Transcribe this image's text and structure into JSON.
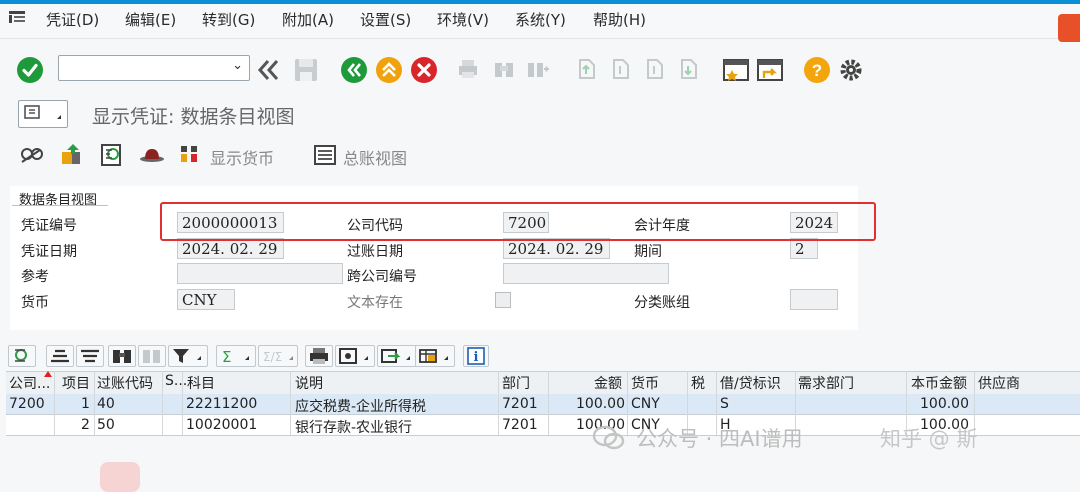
{
  "menu": {
    "items": [
      "凭证(D)",
      "编辑(E)",
      "转到(G)",
      "附加(A)",
      "设置(S)",
      "环境(V)",
      "系统(Y)",
      "帮助(H)"
    ]
  },
  "toolbar": {
    "command_value": "",
    "icons": [
      "enter-icon",
      "back-icon",
      "save-icon",
      "back-green-icon",
      "exit-icon",
      "cancel-icon",
      "print-icon",
      "find-icon",
      "find-next-icon",
      "first-page-icon",
      "prev-page-icon",
      "next-page-icon",
      "last-page-icon",
      "create-session-icon",
      "shortcut-icon",
      "help-icon",
      "settings-icon"
    ]
  },
  "page": {
    "title": "显示凭证: 数据条目视图"
  },
  "app_toolbar": {
    "display_currency": "显示货币",
    "gl_view": "总账视图"
  },
  "panel": {
    "title": "数据条目视图",
    "doc_number_label": "凭证编号",
    "doc_number": "2000000013",
    "company_code_label": "公司代码",
    "company_code": "7200",
    "fiscal_year_label": "会计年度",
    "fiscal_year": "2024",
    "doc_date_label": "凭证日期",
    "doc_date": "2024. 02. 29",
    "posting_date_label": "过账日期",
    "posting_date": "2024. 02. 29",
    "period_label": "期间",
    "period": "2",
    "reference_label": "参考",
    "reference": "",
    "cross_company_label": "跨公司编号",
    "cross_company": "",
    "currency_label": "货币",
    "currency": "CNY",
    "text_exists_label": "文本存在",
    "ledger_group_label": "分类账组",
    "ledger_group": ""
  },
  "grid": {
    "headers": [
      "公司...",
      "项目",
      "过账代码",
      "S...",
      "科目",
      "说明",
      "部门",
      "金额",
      "货币",
      "税",
      "借/贷标识",
      "需求部门",
      "本币金额",
      "供应商"
    ],
    "rows": [
      {
        "company": "7200",
        "item": "1",
        "posting_key": "40",
        "s": "",
        "account": "22211200",
        "desc": "应交税费-企业所得税",
        "dept": "7201",
        "amount": "100.00",
        "currency": "CNY",
        "tax": "",
        "dc": "S",
        "req_dept": "",
        "local_amount": "100.00",
        "vendor": ""
      },
      {
        "company": "",
        "item": "2",
        "posting_key": "50",
        "s": "",
        "account": "10020001",
        "desc": "银行存款-农业银行",
        "dept": "7201",
        "amount": "100.00",
        "currency": "CNY",
        "tax": "",
        "dc": "H",
        "req_dept": "",
        "local_amount": "100.00",
        "vendor": ""
      }
    ]
  },
  "watermark": {
    "wechat": "公众号 · 四AI谱用",
    "zhihu": "知乎 @ 斯"
  }
}
